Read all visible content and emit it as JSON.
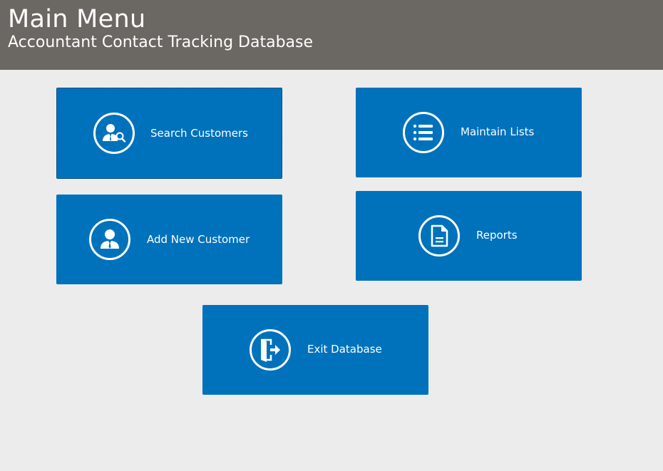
{
  "header": {
    "title": "Main Menu",
    "subtitle": "Accountant Contact Tracking Database"
  },
  "tiles": {
    "search_customers": {
      "label": "Search Customers",
      "icon": "user-search-icon"
    },
    "maintain_lists": {
      "label": "Maintain Lists",
      "icon": "list-icon"
    },
    "add_new_customer": {
      "label": "Add New Customer",
      "icon": "user-icon"
    },
    "reports": {
      "label": "Reports",
      "icon": "document-icon"
    },
    "exit_database": {
      "label": "Exit Database",
      "icon": "exit-door-icon"
    }
  },
  "colors": {
    "header_bg": "#6b6762",
    "page_bg": "#ececec",
    "tile_bg": "#0072bc",
    "text_on_tile": "#ffffff"
  }
}
